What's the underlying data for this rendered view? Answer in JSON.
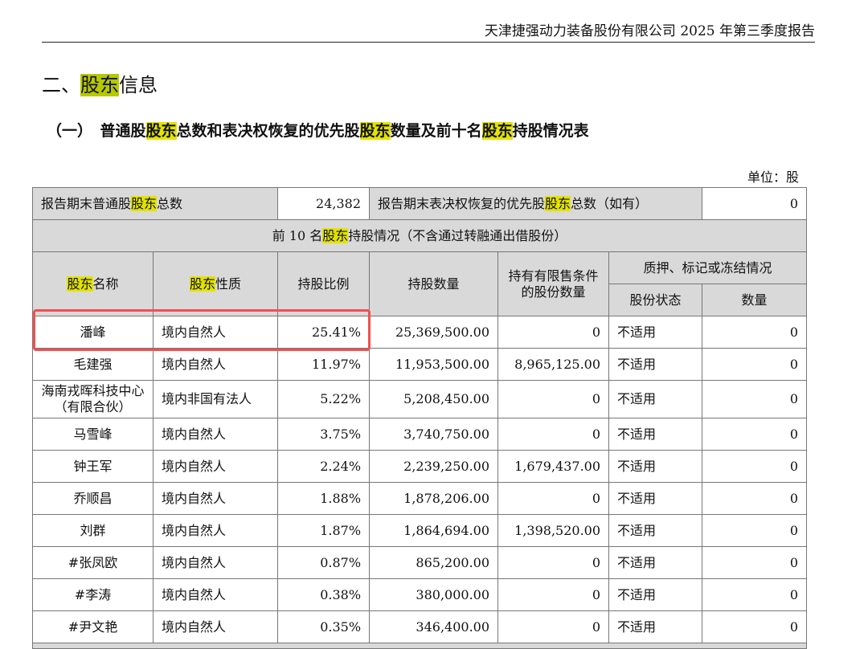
{
  "header": "天津捷强动力装备股份有限公司 2025 年第三季度报告",
  "section": {
    "pre": "二、",
    "hl": "股东",
    "post": "信息"
  },
  "subsection": {
    "a": "（一）　普通股",
    "b": "股东",
    "c": "总数和表决权恢复的优先股",
    "d": "股东",
    "e": "数量及前十名",
    "f": "股东",
    "g": "持股情况表"
  },
  "unit": "单位：股",
  "summary": {
    "label1_pre": "报告期末普通股",
    "label1_post": "总数",
    "value1": "24,382",
    "label2_pre": "报告期末表决权恢复的优先股",
    "label2_post": "总数（如有）",
    "value2": "0",
    "hl": "股东"
  },
  "top10_title": {
    "pre": "前 10 名",
    "hl": "股东",
    "post": "持股情况（不含通过转融通出借股份）"
  },
  "columns": {
    "hl": "股东",
    "name": "名称",
    "nature": "性质",
    "ratio": "持股比例",
    "qty": "持股数量",
    "restricted": "持有有限售条件的股份数量",
    "pledge": "质押、标记或冻结情况",
    "status": "股份状态",
    "count": "数量"
  },
  "rows": [
    {
      "name": "潘峰",
      "nature": "境内自然人",
      "ratio": "25.41%",
      "qty": "25,369,500.00",
      "restricted": "0",
      "status": "不适用",
      "count": "0"
    },
    {
      "name": "毛建强",
      "nature": "境内自然人",
      "ratio": "11.97%",
      "qty": "11,953,500.00",
      "restricted": "8,965,125.00",
      "status": "不适用",
      "count": "0"
    },
    {
      "name": "海南戎晖科技中心（有限合伙）",
      "nature": "境内非国有法人",
      "ratio": "5.22%",
      "qty": "5,208,450.00",
      "restricted": "0",
      "status": "不适用",
      "count": "0"
    },
    {
      "name": "马雪峰",
      "nature": "境内自然人",
      "ratio": "3.75%",
      "qty": "3,740,750.00",
      "restricted": "0",
      "status": "不适用",
      "count": "0"
    },
    {
      "name": "钟王军",
      "nature": "境内自然人",
      "ratio": "2.24%",
      "qty": "2,239,250.00",
      "restricted": "1,679,437.00",
      "status": "不适用",
      "count": "0"
    },
    {
      "name": "乔顺昌",
      "nature": "境内自然人",
      "ratio": "1.88%",
      "qty": "1,878,206.00",
      "restricted": "0",
      "status": "不适用",
      "count": "0"
    },
    {
      "name": "刘群",
      "nature": "境内自然人",
      "ratio": "1.87%",
      "qty": "1,864,694.00",
      "restricted": "1,398,520.00",
      "status": "不适用",
      "count": "0"
    },
    {
      "name": "#张凤欧",
      "nature": "境内自然人",
      "ratio": "0.87%",
      "qty": "865,200.00",
      "restricted": "0",
      "status": "不适用",
      "count": "0"
    },
    {
      "name": "#李涛",
      "nature": "境内自然人",
      "ratio": "0.38%",
      "qty": "380,000.00",
      "restricted": "0",
      "status": "不适用",
      "count": "0"
    },
    {
      "name": "#尹文艳",
      "nature": "境内自然人",
      "ratio": "0.35%",
      "qty": "346,400.00",
      "restricted": "0",
      "status": "不适用",
      "count": "0"
    }
  ]
}
